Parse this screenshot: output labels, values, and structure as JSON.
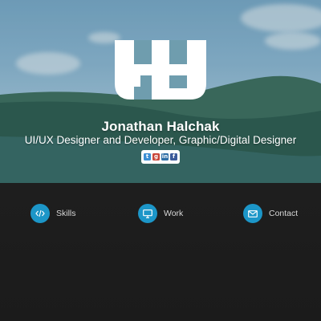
{
  "profile": {
    "name": "Jonathan Halchak",
    "tagline": "UI/UX Designer and Developer, Graphic/Digital Designer",
    "logo_icon": "jh-monogram-logo"
  },
  "social": [
    {
      "id": "twitter",
      "glyph": "t",
      "color": "#3c8fd4"
    },
    {
      "id": "google-plus",
      "glyph": "g",
      "color": "#c9463a"
    },
    {
      "id": "linkedin",
      "glyph": "in",
      "color": "#2f6fa6"
    },
    {
      "id": "facebook",
      "glyph": "f",
      "color": "#3b5a9a"
    }
  ],
  "nav": {
    "items": [
      {
        "label": "Skills",
        "icon": "code-icon"
      },
      {
        "label": "Work",
        "icon": "monitor-icon"
      },
      {
        "label": "Contact",
        "icon": "envelope-icon"
      }
    ]
  },
  "colors": {
    "accent": "#1c96c8",
    "background": "#1b1b1b",
    "text": "#ffffff"
  }
}
